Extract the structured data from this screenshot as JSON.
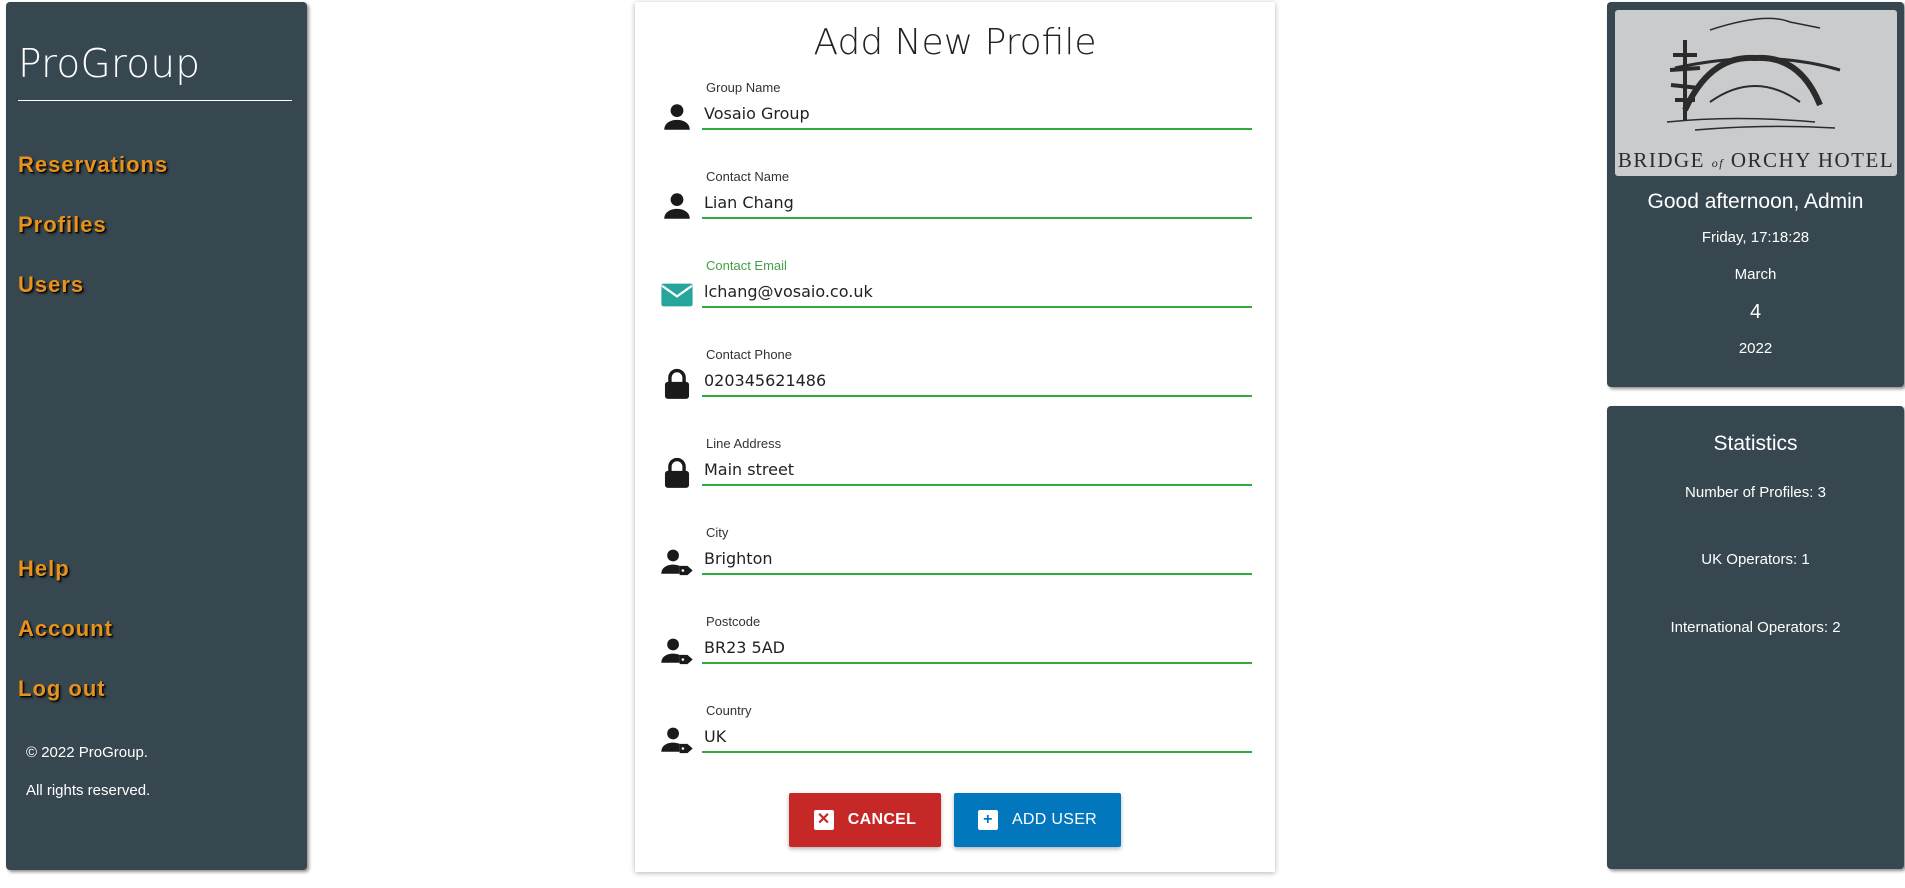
{
  "sidebar": {
    "brand": "ProGroup",
    "nav": [
      {
        "label": "Reservations"
      },
      {
        "label": "Profiles"
      },
      {
        "label": "Users"
      }
    ],
    "bottom_nav": [
      {
        "label": "Help"
      },
      {
        "label": "Account"
      },
      {
        "label": "Log out"
      }
    ],
    "copyright": "© 2022 ProGroup.",
    "rights": "All rights reserved.",
    "link_color": "#e8921c",
    "bg_color": "#37474f"
  },
  "form": {
    "title": "Add New Profile",
    "fields": [
      {
        "label": "Group Name",
        "value": "Vosaio Group",
        "icon": "person-icon"
      },
      {
        "label": "Contact Name",
        "value": "Lian Chang",
        "icon": "person-icon"
      },
      {
        "label": "Contact Email",
        "value": "lchang@vosaio.co.uk",
        "icon": "email-icon",
        "focused": true
      },
      {
        "label": "Contact Phone",
        "value": "020345621486",
        "icon": "lock-icon"
      },
      {
        "label": "Line Address",
        "value": "Main street",
        "icon": "lock-icon"
      },
      {
        "label": "City",
        "value": "Brighton",
        "icon": "person-tag-icon"
      },
      {
        "label": "Postcode",
        "value": "BR23 5AD",
        "icon": "person-tag-icon"
      },
      {
        "label": "Country",
        "value": "UK",
        "icon": "person-tag-icon"
      }
    ],
    "cancel_label": "CANCEL",
    "add_label": "ADD USER",
    "cancel_color": "#c62828",
    "add_color": "#0277bd",
    "underline_color": "#2eac40"
  },
  "info_panel": {
    "logo_text_a": "BRIDGE",
    "logo_text_of": "of",
    "logo_text_b": "ORCHY HOTEL",
    "greeting": "Good afternoon, Admin",
    "day_time": "Friday, 17:18:28",
    "month": "March",
    "day": "4",
    "year": "2022"
  },
  "stats_panel": {
    "title": "Statistics",
    "items": [
      {
        "label": "Number of Profiles: 3"
      },
      {
        "label": "UK Operators: 1"
      },
      {
        "label": "International Operators: 2"
      }
    ]
  }
}
